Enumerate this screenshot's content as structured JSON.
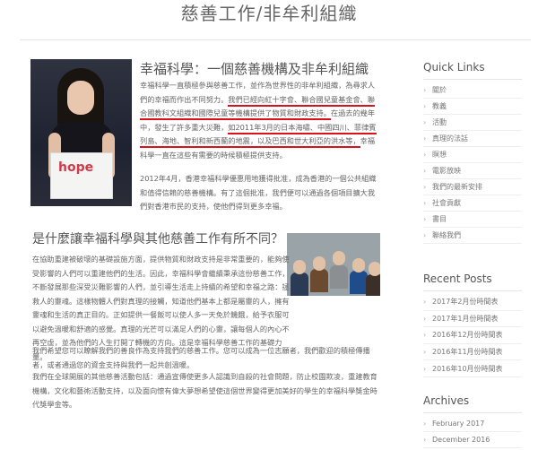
{
  "page": {
    "title": "慈善工作/非牟利組織"
  },
  "hero": {
    "box_logo": "hope"
  },
  "article": {
    "title": "幸福科學：一個慈善機構及非牟利組織",
    "p1": {
      "a": "幸福科學一直積極參與慈善工作，並作為世界性的非牟利組織，為尋求人們的幸福而作出不同努力。",
      "u1": "我們已經向紅十字會、聯合國兒童基金會、聯合國教科文組織和國際兒童等機構提供了物質和財政支持。",
      "b": "在過去的幾年中，發生了許多重大災難，",
      "u2": "如2011年3月的日本海嘯、中國四川、菲律賓列島、海地、智利和新西蘭的地震，以及巴西和世大利亞的洪水等，",
      "c": "幸福科學一直在這些有需要的時候積極提供支持。"
    },
    "p2": "2012年4月，香港幸福科學優惠用地獲得批准，成為香港的一個公共組織和值得信賴的慈善機構。有了這個批准，我們便可以通過各個項目擴大我們對香港市民的支持，使他們得到更多幸福。",
    "section_title": "是什麼讓幸福科學與其他慈善工作有所不同？",
    "p3": "在協助重建被破壞的基礎設施方面，提供物質和財政支持是非常重要的，能夠使受影響的人們可以重建他們的生活。因此，幸福科學會繼續秉承這份慈善工作，不斷發展那些深受災難影響的人們，並引導生活走上持續的希望和幸福之路：拯救人的靈魂。這樣物體人們對真理的接觸，知道他們基本上都是屬靈的人，擁有靈魂和生活的真正目的。正如提供一餐飯可以使人多一天免於饑餓，給予衣服可以避免溫暖和舒適的感覺。真理的光芒可以滿足人們的心靈，讓每個人的內心不再空虛，並為他們的人生打開了轉機的方向。這是幸福科學慈善工作的基礎力量。",
    "p4": "我們希望您可以瞭解我們的善良作為支持我們的慈善工作。您可以成為一位志願者，我們歡迎的積極傳播者，或者通過您的資金支持與我們一起共創溫暖。",
    "p5": "我們在全球開展的其他慈善活動包括：通過宣傳使更多人認識到自殺的社會問題，防止校園欺凌，重建教育機構，文化和藝術活動支持，以及面向懷有偉大夢想希望使這個世界變得更加美好的學生的幸福科學獎金時代獎學金等。"
  },
  "sidebar": {
    "quick_links_title": "Quick Links",
    "quick_links": [
      "關於",
      "教義",
      "活動",
      "真理的法話",
      "瞑想",
      "電影放映",
      "我們的最新安排",
      "社會貢獻",
      "書目",
      "聯絡我們"
    ],
    "recent_posts_title": "Recent Posts",
    "recent_posts": [
      "2017年2月份時間表",
      "2017年1月份時間表",
      "2016年12月份時間表",
      "2016年11月份時間表",
      "2016年10月份時間表"
    ],
    "archives_title": "Archives",
    "archives": [
      "February 2017",
      "December 2016"
    ]
  },
  "colors": {
    "underline": "#d7141d",
    "text": "#666666"
  }
}
